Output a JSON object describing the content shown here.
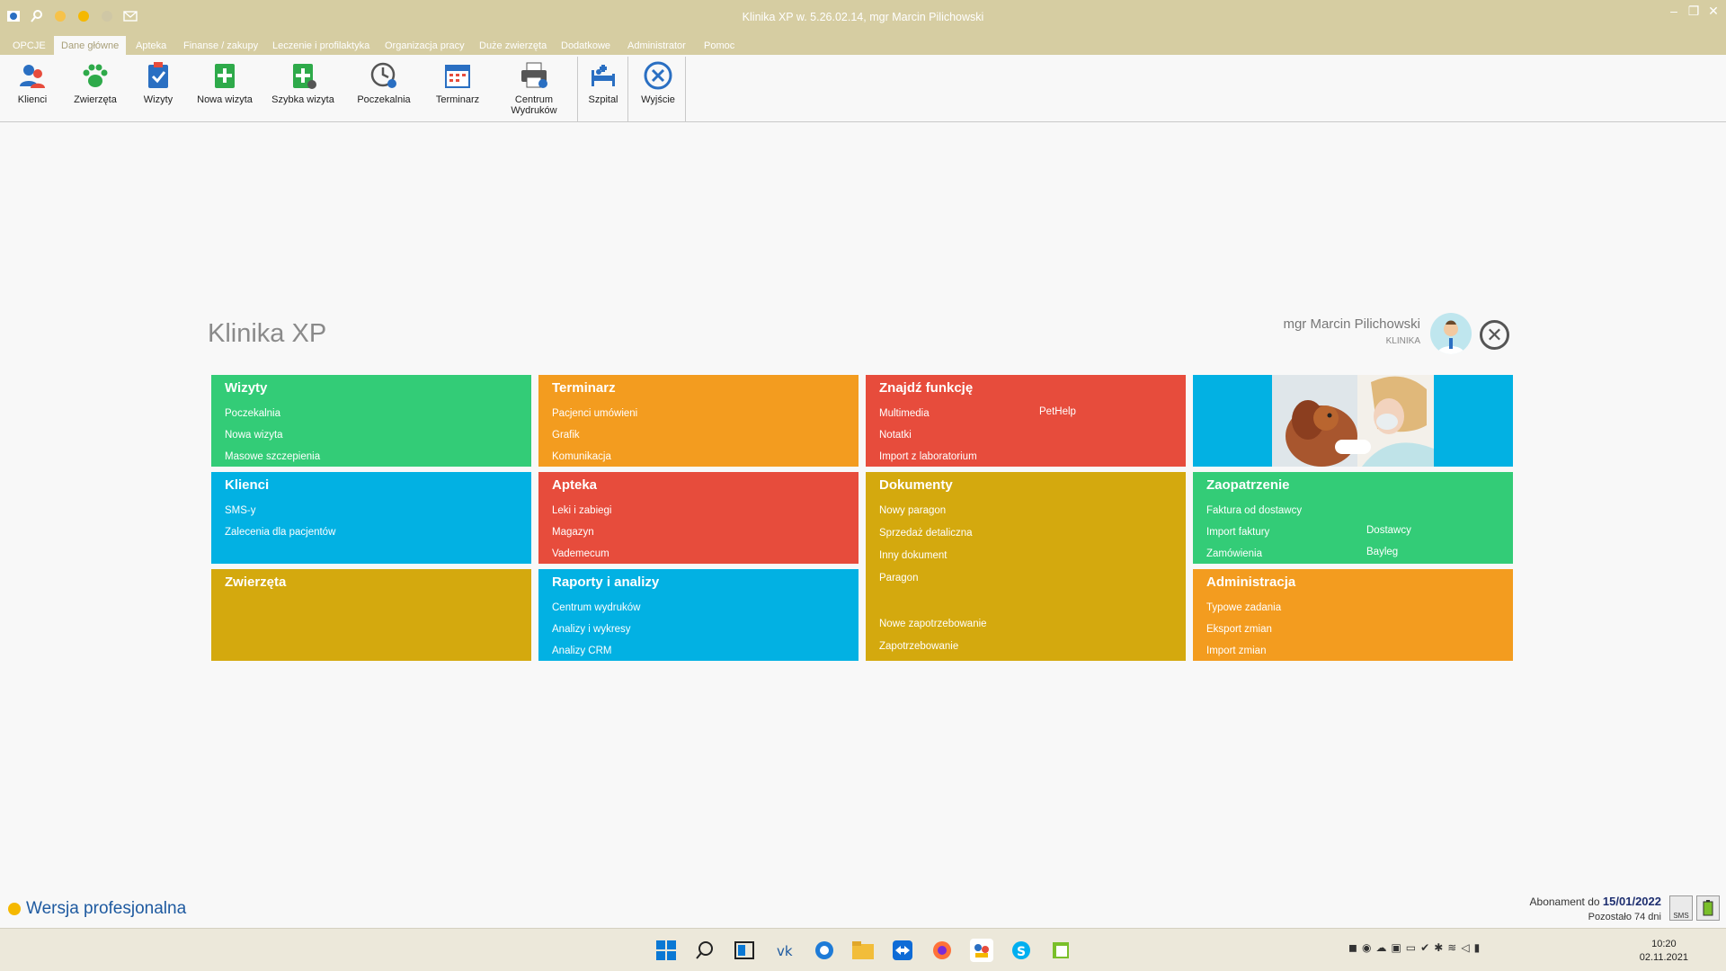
{
  "window": {
    "title": "Klinika XP w. 5.26.02.14, mgr Marcin Pilichowski",
    "controls": [
      "–",
      "❐",
      "✕"
    ]
  },
  "quick_access": [
    "app-icon",
    "search-icon",
    "sun-icon",
    "sun-icon",
    "circle-icon",
    "mail-icon"
  ],
  "menu": {
    "tabs": [
      "OPCJE",
      "Dane główne",
      "Apteka",
      "Finanse / zakupy",
      "Leczenie i profilaktyka",
      "Organizacja pracy",
      "Duże zwierzęta",
      "Dodatkowe",
      "Administrator",
      "Pomoc"
    ],
    "active": "Dane główne"
  },
  "ribbon": {
    "buttons": [
      {
        "label": "Klienci",
        "icon": "people-icon",
        "color": "#2a6fc2"
      },
      {
        "label": "Zwierzęta",
        "icon": "paw-icon",
        "color": "#2eaa4a"
      },
      {
        "label": "Wizyty",
        "icon": "clipboard-check-icon",
        "color": "#2a6fc2"
      },
      {
        "label": "Nowa wizyta",
        "icon": "add-visit-icon",
        "color": "#2eaa4a"
      },
      {
        "label": "Szybka wizyta",
        "icon": "quick-visit-icon",
        "color": "#2eaa4a"
      },
      {
        "label": "Poczekalnia",
        "icon": "clock-icon",
        "color": "#555555"
      },
      {
        "label": "Terminarz",
        "icon": "calendar-icon",
        "color": "#2a6fc2"
      },
      {
        "label": "Centrum",
        "label2": "Wydruków",
        "icon": "printer-icon",
        "color": "#2a6fc2"
      },
      {
        "label": "Szpital",
        "icon": "hospital-bed-icon",
        "color": "#2a6fc2"
      },
      {
        "label": "Wyjście",
        "icon": "exit-icon",
        "color": "#2a6fc2"
      }
    ]
  },
  "dashboard": {
    "app_title": "Klinika XP",
    "user_name": "mgr Marcin Pilichowski",
    "user_role": "KLINIKA",
    "tiles": {
      "wizyty": {
        "title": "Wizyty",
        "items": [
          "Poczekalnia",
          "Nowa wizyta",
          "Masowe szczepienia"
        ]
      },
      "terminarz": {
        "title": "Terminarz",
        "items": [
          "Pacjenci umówieni",
          "Grafik",
          "Komunikacja"
        ]
      },
      "znajdz": {
        "title": "Znajdź funkcję",
        "items": [
          "Multimedia",
          "Notatki",
          "Import z laboratorium"
        ],
        "items2": [
          "PetHelp"
        ]
      },
      "klienci": {
        "title": "Klienci",
        "items": [
          "SMS-y",
          "Zalecenia dla pacjentów"
        ]
      },
      "apteka": {
        "title": "Apteka",
        "items": [
          "Leki i zabiegi",
          "Magazyn",
          "Vademecum"
        ]
      },
      "dokumenty": {
        "title": "Dokumenty",
        "items": [
          "Nowy paragon",
          "Sprzedaż detaliczna",
          "Inny dokument",
          "Paragon"
        ],
        "items2": [
          "Nowe zapotrzebowanie",
          "Zapotrzebowanie"
        ]
      },
      "zaopatrzenie": {
        "title": "Zaopatrzenie",
        "items": [
          "Faktura od dostawcy",
          "Import faktury",
          "Zamówienia"
        ],
        "items2": [
          "Dostawcy",
          "Bayleg"
        ]
      },
      "zwierzeta": {
        "title": "Zwierzęta",
        "items": []
      },
      "raporty": {
        "title": "Raporty i analizy",
        "items": [
          "Centrum wydruków",
          "Analizy i wykresy",
          "Analizy CRM"
        ]
      },
      "administracja": {
        "title": "Administracja",
        "items": [
          "Typowe zadania",
          "Eksport zmian",
          "Import zmian"
        ]
      }
    }
  },
  "status": {
    "version": "Wersja profesjonalna",
    "abonament_label": "Abonament do",
    "abonament_date": "15/01/2022",
    "remaining": "Pozostało 74 dni",
    "sms_label": "SMS"
  },
  "taskbar": {
    "time": "10:20",
    "date": "02.11.2021"
  }
}
